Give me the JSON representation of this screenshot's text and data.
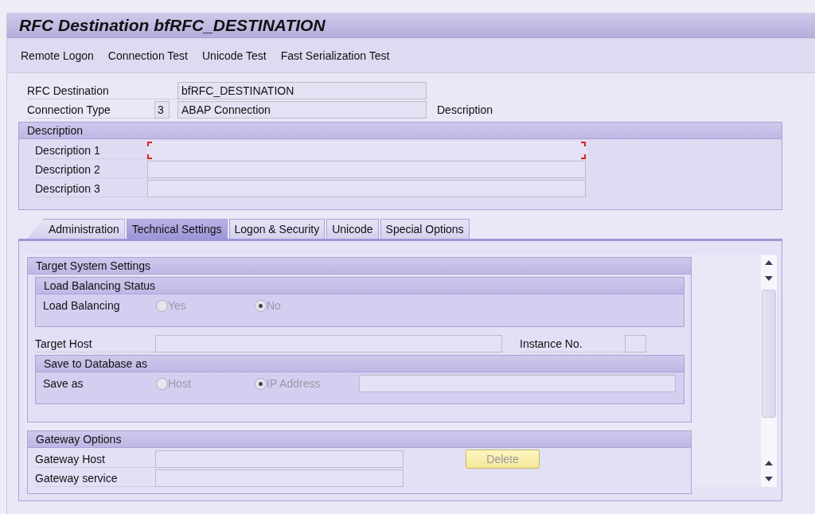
{
  "window": {
    "title": "RFC Destination bfRFC_DESTINATION"
  },
  "toolbar": [
    "Remote Logon",
    "Connection Test",
    "Unicode Test",
    "Fast Serialization Test"
  ],
  "rfc_destination": {
    "label": "RFC Destination",
    "value": "bfRFC_DESTINATION"
  },
  "connection_type": {
    "label": "Connection Type",
    "code": "3",
    "value": "ABAP Connection",
    "description_label": "Description"
  },
  "description_group": {
    "title": "Description",
    "fields": [
      {
        "label": "Description 1",
        "focused": true
      },
      {
        "label": "Description 2",
        "focused": false
      },
      {
        "label": "Description 3",
        "focused": false
      }
    ]
  },
  "tabs": [
    {
      "label": "Administration",
      "selected": false
    },
    {
      "label": "Technical Settings",
      "selected": true
    },
    {
      "label": "Logon & Security",
      "selected": false
    },
    {
      "label": "Unicode",
      "selected": false
    },
    {
      "label": "Special Options",
      "selected": false
    }
  ],
  "target_system_settings": {
    "title": "Target System Settings",
    "load_balancing_status": {
      "title": "Load Balancing Status",
      "label": "Load Balancing",
      "options": [
        {
          "label": "Yes",
          "selected": false
        },
        {
          "label": "No",
          "selected": true
        }
      ]
    },
    "target_host": {
      "label": "Target Host"
    },
    "instance_no": {
      "label": "Instance No."
    },
    "save_to_database": {
      "title": "Save to Database as",
      "label": "Save as",
      "options": [
        {
          "label": "Host",
          "selected": false
        },
        {
          "label": "IP Address",
          "selected": true
        }
      ]
    }
  },
  "gateway_options": {
    "title": "Gateway Options",
    "fields": [
      {
        "label": "Gateway Host"
      },
      {
        "label": "Gateway service"
      }
    ],
    "delete_button": {
      "label": "Delete",
      "disabled": true
    }
  }
}
